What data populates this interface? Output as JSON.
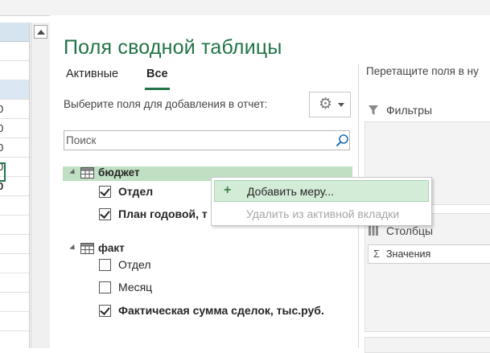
{
  "pane": {
    "title": "Поля сводной таблицы",
    "tabs": [
      {
        "label": "Активные",
        "active": false
      },
      {
        "label": "Все",
        "active": true
      }
    ],
    "choose_label": "Выберите поля для добавления в отчет:",
    "search": {
      "placeholder": "Поиск",
      "value": ""
    }
  },
  "tables": [
    {
      "name": "бюджет",
      "fields": [
        {
          "label": "Отдел",
          "checked": true
        },
        {
          "label": "План годовой, т",
          "checked": true
        }
      ]
    },
    {
      "name": "факт",
      "fields": [
        {
          "label": "Отдел",
          "checked": false
        },
        {
          "label": "Месяц",
          "checked": false
        },
        {
          "label": "Фактическая сумма сделок, тыс.руб.",
          "checked": true
        }
      ]
    }
  ],
  "areas": {
    "drag_hint": "Перетащите поля в ну",
    "filters": "Фильтры",
    "columns": "Столбцы",
    "values_item": "Значения"
  },
  "context_menu": {
    "items": [
      {
        "label": "Добавить меру...",
        "enabled": true
      },
      {
        "label": "Удалить из активной вкладки",
        "enabled": false
      }
    ]
  },
  "sheet": {
    "cells": [
      "0",
      "0",
      "0",
      "0",
      "0"
    ]
  },
  "colors": {
    "accent": "#217346",
    "highlight": "#bfe0c2"
  }
}
